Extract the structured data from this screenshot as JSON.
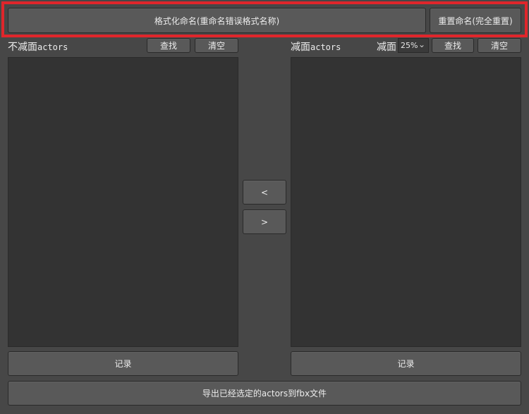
{
  "top": {
    "format_rename_label": "格式化命名(重命名错误格式名称)",
    "reset_rename_label": "重置命名(完全重置)"
  },
  "left": {
    "title_prefix": "不减面",
    "title_suffix": "actors",
    "find_label": "查找",
    "clear_label": "清空",
    "record_label": "记录"
  },
  "right": {
    "title_prefix": "减面",
    "title_suffix": "actors",
    "reduce_label": "减面",
    "percent_value": "25%",
    "find_label": "查找",
    "clear_label": "清空",
    "record_label": "记录"
  },
  "middle": {
    "move_left_label": "<",
    "move_right_label": ">"
  },
  "export_label": "导出已经选定的actors到fbx文件"
}
